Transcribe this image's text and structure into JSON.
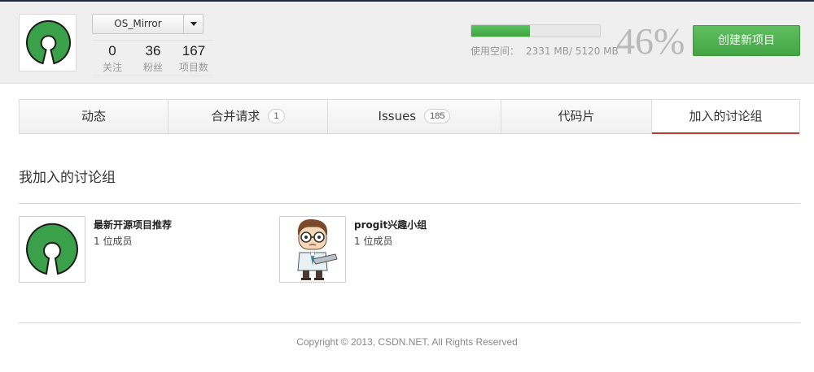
{
  "header": {
    "username": "OS_Mirror",
    "stats": [
      {
        "value": "0",
        "label": "关注"
      },
      {
        "value": "36",
        "label": "粉丝"
      },
      {
        "value": "167",
        "label": "项目数"
      }
    ],
    "quota": {
      "label": "使用空间：",
      "used": "2331 MB/ 5120 MB",
      "percent_text": "46%",
      "fraction": 0.455
    },
    "create_button": "创建新项目"
  },
  "tabs": [
    {
      "label": "动态",
      "badge": null,
      "active": false
    },
    {
      "label": "合并请求",
      "badge": "1",
      "active": false
    },
    {
      "label": "Issues",
      "badge": "185",
      "active": false
    },
    {
      "label": "代码片",
      "badge": null,
      "active": false
    },
    {
      "label": "加入的讨论组",
      "badge": null,
      "active": true
    }
  ],
  "section": {
    "title": "我加入的讨论组"
  },
  "groups": [
    {
      "name": "最新开源项目推荐",
      "members": "1 位成员",
      "icon": "open-source-logo-icon"
    },
    {
      "name": "progit兴趣小组",
      "members": "1 位成员",
      "icon": "nerd-character-icon"
    }
  ],
  "footer": {
    "copyright": "Copyright © 2013, CSDN.NET, All Rights Reserved"
  },
  "colors": {
    "accent_green": "#42a542",
    "active_tab_underline": "#c0392b",
    "logo_green": "#3aa14a"
  }
}
